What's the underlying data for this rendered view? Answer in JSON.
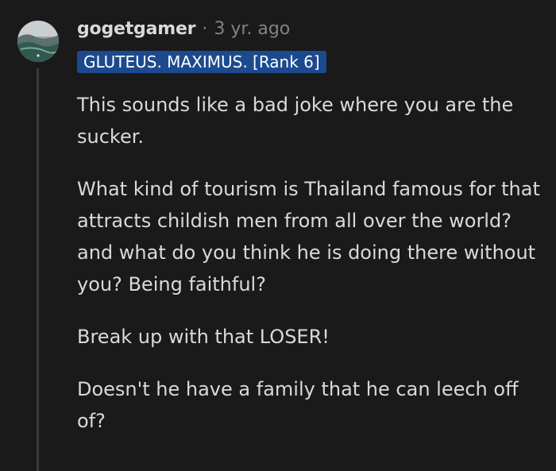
{
  "comment": {
    "author": "gogetgamer",
    "separator": "·",
    "timestamp": "3 yr. ago",
    "flair": "GLUTEUS. MAXIMUS. [Rank 6]",
    "paragraphs": [
      "This sounds like a bad joke where you are the sucker.",
      "What kind of tourism is Thailand famous for that attracts childish men from all over the world? and what do you think he is doing there without you? Being faithful?",
      "Break up with that LOSER!",
      "Doesn't he have a family that he can leech off of?"
    ]
  },
  "colors": {
    "background": "#1a1a1b",
    "text": "#d7dadc",
    "muted": "#818384",
    "flair_bg": "#1c4a8f",
    "thread_line": "#3a3a3c"
  },
  "icons": {
    "avatar": "user-avatar-wave-image"
  }
}
